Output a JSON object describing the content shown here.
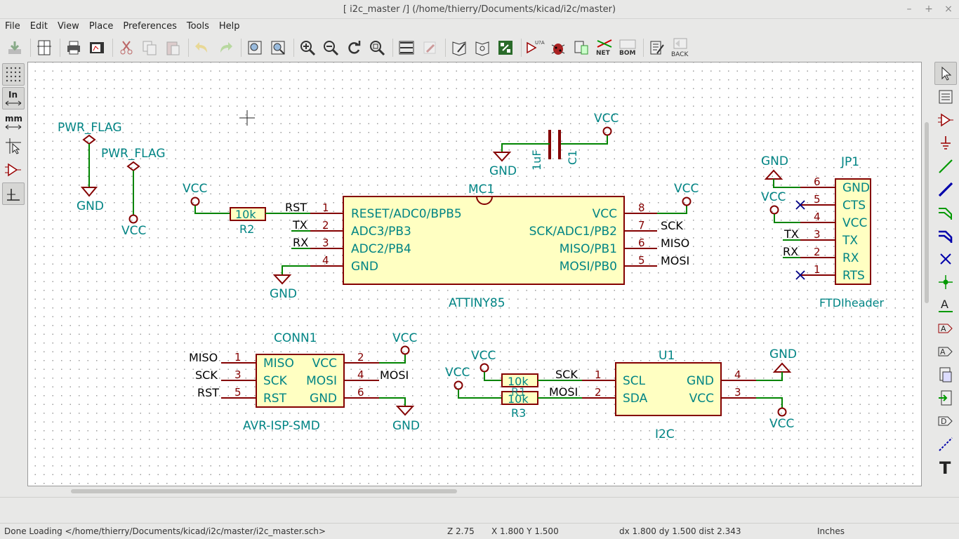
{
  "window": {
    "title": "[ i2c_master /] (/home/thierry/Documents/kicad/i2c/master)"
  },
  "menubar": {
    "items": [
      "File",
      "Edit",
      "View",
      "Place",
      "Preferences",
      "Tools",
      "Help"
    ]
  },
  "toolbar": {
    "icons": [
      "save-sheet-icon",
      "page-settings-icon",
      "print-icon",
      "plot-icon",
      "cut-icon",
      "copy-icon",
      "paste-icon",
      "undo-icon",
      "redo-icon",
      "find-icon",
      "find-replace-icon",
      "zoom-in-icon",
      "zoom-out-icon",
      "redraw-icon",
      "zoom-fit-icon",
      "hierarchy-navigator-icon",
      "leave-sheet-icon",
      "library-editor-icon",
      "library-browser-icon",
      "pcbnew-icon",
      "annotate-icon",
      "erc-icon",
      "cvpcb-icon",
      "netlist-icon",
      "bom-icon",
      "edit-fields-icon",
      "back-import-icon"
    ],
    "annotate_label": "U?A 123",
    "netlist_label": "NET",
    "bom_label": "BOM",
    "back_label": "BACK"
  },
  "left_toolbar": {
    "inches_label": "In",
    "mm_label": "mm"
  },
  "right_toolbar": {
    "text_tool_label": "T",
    "label_tool_label": "A",
    "hier_label_glyph": "A"
  },
  "schematic": {
    "pwr_flag_1": {
      "name": "PWR_FLAG",
      "net": "GND"
    },
    "pwr_flag_2": {
      "name": "PWR_FLAG",
      "net": "VCC"
    },
    "c1": {
      "ref": "C1",
      "value": "1uF",
      "gnd": "GND",
      "vcc": "VCC"
    },
    "r2": {
      "ref": "R2",
      "value": "10k",
      "vcc": "VCC"
    },
    "mc1": {
      "ref": "MC1",
      "value": "ATTINY85",
      "left_pins": [
        {
          "num": "1",
          "name": "RESET/ADC0/BPB5",
          "net": "RST"
        },
        {
          "num": "2",
          "name": "ADC3/PB3",
          "net": "TX"
        },
        {
          "num": "3",
          "name": "ADC2/PB4",
          "net": "RX"
        },
        {
          "num": "4",
          "name": "GND",
          "net": ""
        }
      ],
      "right_pins": [
        {
          "num": "8",
          "name": "VCC",
          "net": ""
        },
        {
          "num": "7",
          "name": "SCK/ADC1/PB2",
          "net": "SCK"
        },
        {
          "num": "6",
          "name": "MISO/PB1",
          "net": "MISO"
        },
        {
          "num": "5",
          "name": "MOSI/PB0",
          "net": "MOSI"
        }
      ],
      "vcc": "VCC",
      "gnd": "GND"
    },
    "jp1": {
      "ref": "JP1",
      "value": "FTDIheader",
      "pins": [
        {
          "num": "6",
          "name": "GND",
          "net": ""
        },
        {
          "num": "5",
          "name": "CTS",
          "net": ""
        },
        {
          "num": "4",
          "name": "VCC",
          "net": ""
        },
        {
          "num": "3",
          "name": "TX",
          "net": "TX"
        },
        {
          "num": "2",
          "name": "RX",
          "net": "RX"
        },
        {
          "num": "1",
          "name": "RTS",
          "net": ""
        }
      ],
      "gnd": "GND",
      "vcc": "VCC"
    },
    "conn1": {
      "ref": "CONN1",
      "value": "AVR-ISP-SMD",
      "left_pins": [
        {
          "num": "1",
          "name": "MISO",
          "net": "MISO"
        },
        {
          "num": "3",
          "name": "SCK",
          "net": "SCK"
        },
        {
          "num": "5",
          "name": "RST",
          "net": "RST"
        }
      ],
      "right_pins": [
        {
          "num": "2",
          "name": "VCC",
          "net": ""
        },
        {
          "num": "4",
          "name": "MOSI",
          "net": "MOSI"
        },
        {
          "num": "6",
          "name": "GND",
          "net": ""
        }
      ],
      "vcc": "VCC",
      "gnd": "GND"
    },
    "r_i2c": {
      "r_top_value": "10k",
      "r_bottom_value": "10k",
      "overlap_ref": "R1",
      "ref": "R3",
      "vcc_1": "VCC",
      "vcc_2": "VCC",
      "net_scl": "SCK",
      "net_sda": "MOSI"
    },
    "u1": {
      "ref": "U1",
      "value": "I2C",
      "left_pins": [
        {
          "num": "1",
          "name": "SCL"
        },
        {
          "num": "2",
          "name": "SDA"
        }
      ],
      "right_pins": [
        {
          "num": "4",
          "name": "GND"
        },
        {
          "num": "3",
          "name": "VCC"
        }
      ],
      "gnd": "GND",
      "vcc": "VCC"
    }
  },
  "colors": {
    "component_body": "#840000",
    "body_fill": "#ffffc2",
    "label_text": "#008484",
    "wire": "#008400",
    "pin_number": "#840000",
    "net_label": "#000000",
    "no_connect": "#000084"
  },
  "status": {
    "message": "Done Loading </home/thierry/Documents/kicad/i2c/master/i2c_master.sch>",
    "zoom": "Z 2.75",
    "abs_coords": "X 1.800  Y 1.500",
    "rel_coords": "dx 1.800  dy 1.500  dist 2.343",
    "units": "Inches"
  }
}
